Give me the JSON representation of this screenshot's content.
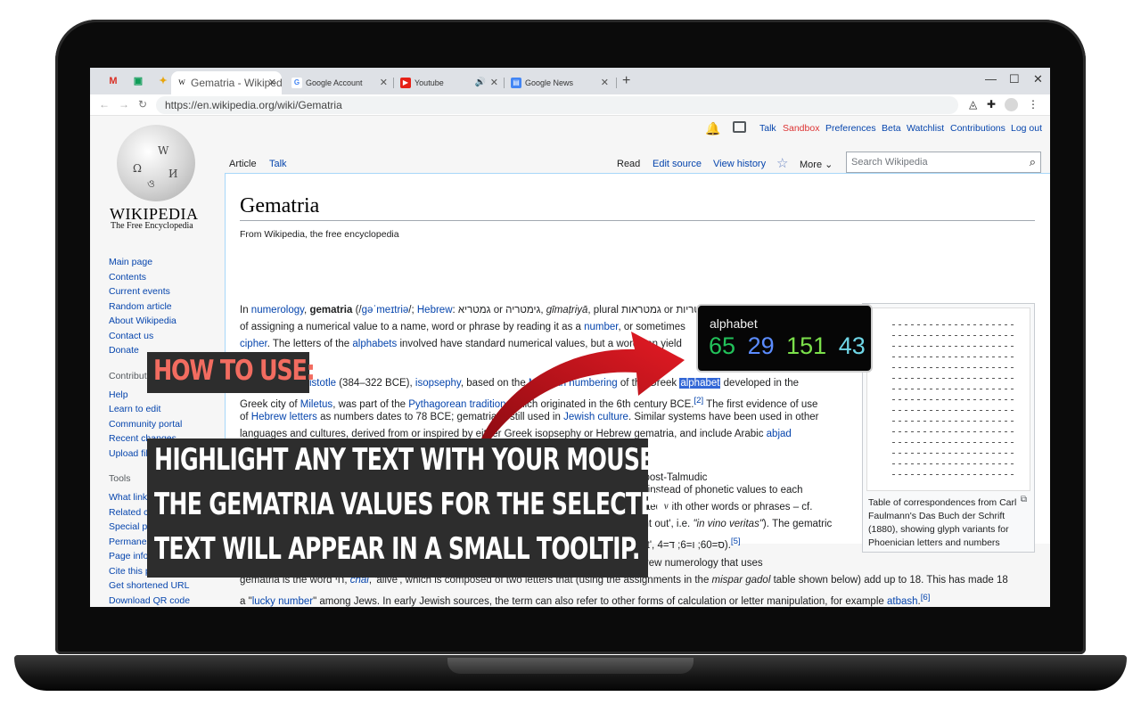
{
  "browser": {
    "tabs": [
      {
        "label": "Gematria - Wikipedi",
        "active": true
      },
      {
        "label": "Google Account"
      },
      {
        "label": "Youtube"
      },
      {
        "label": "Google News"
      }
    ],
    "url": "https://en.wikipedia.org/wiki/Gematria",
    "window_controls": {
      "minimize": "—",
      "maximize": "☐",
      "close": "✕"
    },
    "new_tab": "+"
  },
  "wiki": {
    "logo_name": "WIKIPEDIA",
    "logo_tagline": "The Free Encyclopedia",
    "user_tools": [
      "Talk",
      "Sandbox",
      "Preferences",
      "Beta",
      "Watchlist",
      "Contributions",
      "Log out"
    ],
    "page_tabs_left": [
      "Article",
      "Talk"
    ],
    "page_tabs_right": [
      "Read",
      "Edit source",
      "View history",
      "More"
    ],
    "search_placeholder": "Search Wikipedia",
    "nav_main": [
      "Main page",
      "Contents",
      "Current events",
      "Random article",
      "About Wikipedia",
      "Contact us",
      "Donate"
    ],
    "nav_contribute_heading": "Contribute",
    "nav_contribute": [
      "Help",
      "Learn to edit",
      "Community portal",
      "Recent changes",
      "Upload file"
    ],
    "nav_tools_heading": "Tools",
    "nav_tools": [
      "What links here",
      "Related changes",
      "Special pages",
      "Permanent link",
      "Page information",
      "Cite this page",
      "Get shortened URL",
      "Download QR code"
    ],
    "title": "Gematria",
    "subtitle": "From Wikipedia, the free encyclopedia",
    "figure_caption_1": "Table of correspondences from Carl",
    "figure_caption_2": "Faulmann's Das Buch der Schrift",
    "figure_caption_3": "(1880), showing glyph variants for",
    "figure_caption_4": "Phoenician letters and numbers"
  },
  "tooltip": {
    "word": "alphabet",
    "values": [
      "65",
      "29",
      "151",
      "43"
    ],
    "colors": [
      "#22c25a",
      "#5b8cff",
      "#7be04b",
      "#6fd6e6"
    ]
  },
  "overlay": {
    "heading": "HOW TO USE:",
    "lines": [
      "HIGHLIGHT ANY TEXT WITH YOUR MOUSE.",
      "THE GEMATRIA VALUES FOR THE SELECTED",
      "TEXT WILL APPEAR IN A SMALL TOOLTIP."
    ]
  },
  "colors": {
    "link": "#0645ad",
    "selection": "#3367d6",
    "heading_accent": "#f26c60",
    "arrow": "#d0121b"
  }
}
